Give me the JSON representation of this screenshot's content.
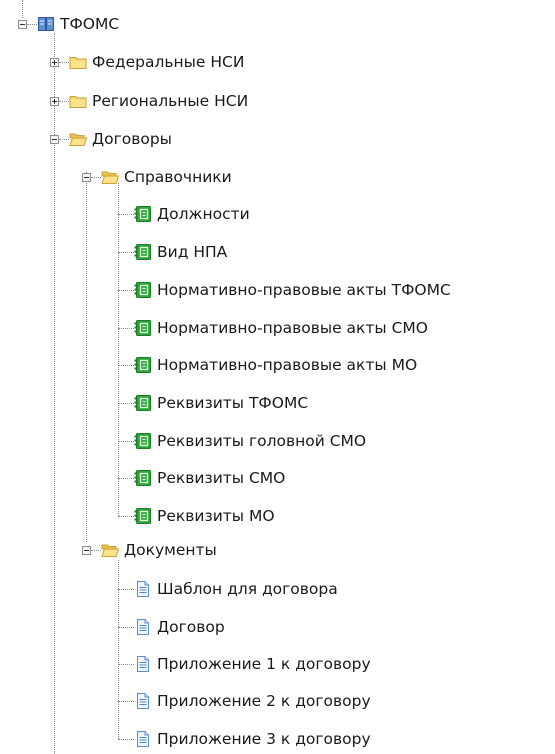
{
  "tree": {
    "root": {
      "label": "ТФОМС",
      "icon": "book-icon",
      "expanded": true
    },
    "level1": [
      {
        "label": "Федеральные НСИ",
        "icon": "folder-closed-icon",
        "expanded": false
      },
      {
        "label": "Региональные НСИ",
        "icon": "folder-closed-icon",
        "expanded": false
      },
      {
        "label": "Договоры",
        "icon": "folder-open-icon",
        "expanded": true
      }
    ],
    "dogovory": [
      {
        "label": "Справочники",
        "icon": "folder-open-icon",
        "expanded": true
      },
      {
        "label": "Документы",
        "icon": "folder-open-icon",
        "expanded": true
      }
    ],
    "spravochniki": [
      {
        "label": "Должности",
        "icon": "catalog-icon"
      },
      {
        "label": "Вид НПА",
        "icon": "catalog-icon"
      },
      {
        "label": "Нормативно-правовые акты ТФОМС",
        "icon": "catalog-icon"
      },
      {
        "label": "Нормативно-правовые акты СМО",
        "icon": "catalog-icon"
      },
      {
        "label": "Нормативно-правовые акты МО",
        "icon": "catalog-icon"
      },
      {
        "label": "Реквизиты ТФОМС",
        "icon": "catalog-icon"
      },
      {
        "label": "Реквизиты головной СМО",
        "icon": "catalog-icon"
      },
      {
        "label": "Реквизиты СМО",
        "icon": "catalog-icon"
      },
      {
        "label": "Реквизиты МО",
        "icon": "catalog-icon"
      }
    ],
    "dokumenty": [
      {
        "label": "Шаблон для договора",
        "icon": "document-icon"
      },
      {
        "label": "Договор",
        "icon": "document-icon"
      },
      {
        "label": "Приложение 1 к договору",
        "icon": "document-icon"
      },
      {
        "label": "Приложение 2 к договору",
        "icon": "document-icon"
      },
      {
        "label": "Приложение 3 к договору",
        "icon": "document-icon"
      }
    ]
  },
  "colors": {
    "folder": "#f5d66b",
    "catalog": "#27a636",
    "document": "#4a86c8",
    "book": "#3f6fb5",
    "tree_line": "#8a8a8a"
  }
}
